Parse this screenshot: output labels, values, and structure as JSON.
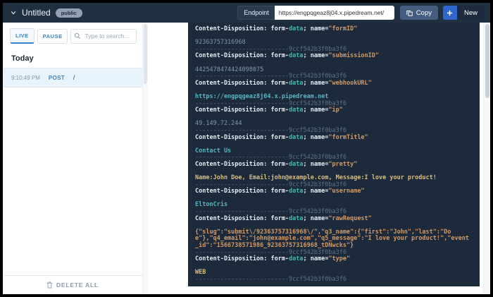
{
  "header": {
    "title": "Untitled",
    "visibility_badge": "public",
    "endpoint_label": "Endpoint",
    "endpoint_url": "https://engpqgeaz8j04.x.pipedream.net/",
    "copy_label": "Copy",
    "new_label": "New"
  },
  "sidebar": {
    "tabs": [
      {
        "label": "LIVE"
      },
      {
        "label": "PAUSE"
      }
    ],
    "search_placeholder": "Type to search...",
    "section_title": "Today",
    "requests": [
      {
        "time": "9:10:49 PM",
        "method": "POST",
        "path": "/"
      }
    ],
    "delete_all_label": "DELETE ALL"
  },
  "request_body": {
    "header_prefix": "Content-Disposition: form-",
    "header_type_highlight": "data",
    "header_name_label": "; name=",
    "boundary": "--------------------------9ccf542b3f0ba3f6",
    "parts": [
      {
        "name_quoted": "\"formID\"",
        "value": "92363757316968",
        "value_style": "muted"
      },
      {
        "name_quoted": "\"submissionID\"",
        "value": "4425478474424098075",
        "value_style": "muted"
      },
      {
        "name_quoted": "\"webhookURL\"",
        "value": "https://engpqgeaz8j04.x.pipedream.net",
        "value_style": "cyan"
      },
      {
        "name_quoted": "\"ip\"",
        "value": "49.149.72.244",
        "value_style": "muted"
      },
      {
        "name_quoted": "\"formTitle\"",
        "value": "Contact Us",
        "value_style": "cyan"
      },
      {
        "name_quoted": "\"pretty\"",
        "value": "Name:John Doe, Email:john@example.com, Message:I love your product!",
        "value_style": "yellow"
      },
      {
        "name_quoted": "\"username\"",
        "value": "EltonCris",
        "value_style": "cyan"
      },
      {
        "name_quoted": "\"rawRequest\"",
        "value": "{\"slug\":\"submit\\/92363757316968\\/\",\"q3_name\":{\"first\":\"John\",\"last\":\"Doe\"},\"q4_email\":\"john@example.com\",\"q5_message\":\"I love your product!\",\"event_id\":\"1566738571986_92363757316968_tDNwcks\"}",
        "value_style": "orange"
      },
      {
        "name_quoted": "\"type\"",
        "value": "WEB",
        "value_style": "yellow"
      }
    ]
  },
  "colors": {
    "topbar_bg": "#213040",
    "code_panel_bg": "#1d2a3b",
    "accent_blue": "#3b82c4",
    "selected_row_bg": "#e9f3fc",
    "code_orange": "#d19a66",
    "code_teal": "#45b8ac",
    "code_cyan": "#56b6c2",
    "code_yellow": "#d9bd7a",
    "code_muted": "#8296ad"
  }
}
